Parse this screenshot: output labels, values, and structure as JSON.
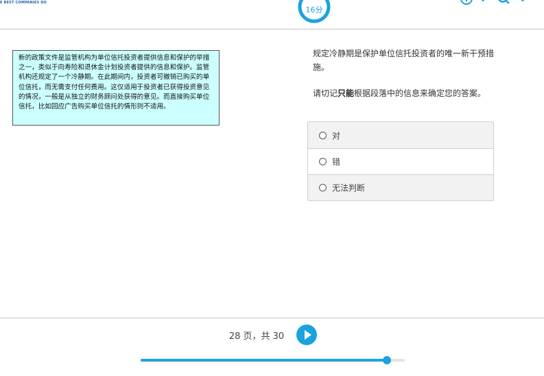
{
  "header": {
    "logo_tagline": "E BEST COMPANIES DO",
    "timer_label": "16分",
    "icons": [
      "info-icon",
      "chevron-down-icon",
      "search-icon",
      "chevron-down-icon"
    ]
  },
  "passage": {
    "text": "新的政策文件是监管机构为单位信托投资者提供信息和保护的举措之一，类似于向寿险和退休金计划投资者提供的信息和保护。监管机构还规定了一个冷静期。在此期间内，投资者可撤销已购买的单位信托，而无需支付任何费用。这仅适用于投资者已获得投资意见的情况，一般是从独立的财务顾问处获得的意见。而直接购买单位信托，比如回应广告购买单位信托的情形则不适用。"
  },
  "question": {
    "statement": "规定冷静期是保护单位信托投资者的唯一新干预措施。",
    "instruction_prefix": "请切记",
    "instruction_bold": "只能",
    "instruction_suffix": "根据段落中的信息来确定您的答案。",
    "options": [
      {
        "label": "对"
      },
      {
        "label": "错"
      },
      {
        "label": "无法判断"
      }
    ]
  },
  "footer": {
    "page_info": "28 页，共 30",
    "progress_fraction": 0.933
  },
  "colors": {
    "accent": "#1aa3dd",
    "passage_bg": "#ccffff"
  }
}
